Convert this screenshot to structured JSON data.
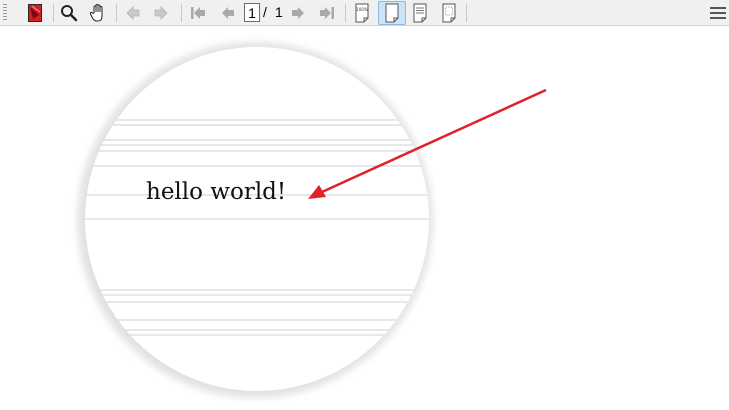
{
  "toolbar": {
    "items": [
      {
        "name": "app-logo-icon",
        "enabled": true
      },
      {
        "name": "search-icon",
        "enabled": true
      },
      {
        "name": "hand-icon",
        "enabled": true
      },
      {
        "name": "back-arrow-icon",
        "enabled": false
      },
      {
        "name": "forward-arrow-icon",
        "enabled": false
      },
      {
        "name": "first-page-icon",
        "enabled": false
      },
      {
        "name": "previous-page-icon",
        "enabled": false
      },
      {
        "name": "next-page-icon",
        "enabled": false
      },
      {
        "name": "last-page-icon",
        "enabled": false
      },
      {
        "name": "zoom-100-icon",
        "label": "100%"
      },
      {
        "name": "fit-page-icon",
        "pressed": true
      },
      {
        "name": "fit-width-icon"
      },
      {
        "name": "fit-visible-icon"
      },
      {
        "name": "menu-icon"
      }
    ],
    "page_current": "1",
    "page_separator": "/",
    "page_total": "1",
    "zoom_label": "100%"
  },
  "document": {
    "text": "hello world!"
  },
  "colors": {
    "toolbar_bg": "#f0f0f0",
    "arrow": "#e0202a",
    "logo_red": "#d11f26",
    "pressed_bg": "#cde4f7"
  }
}
